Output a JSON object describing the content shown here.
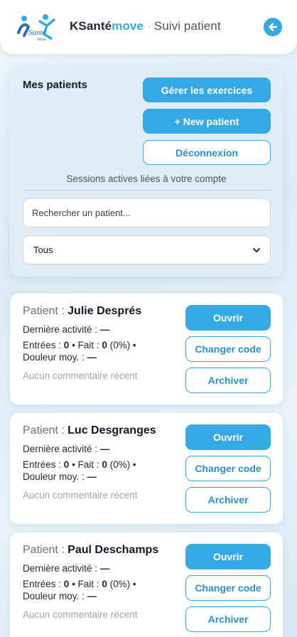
{
  "header": {
    "brand_main": "KSanté",
    "brand_accent": "move",
    "separator": "·",
    "subtitle": "Suivi patient",
    "logo_text": "Santé Move",
    "accent_color": "#35a8e6"
  },
  "panel": {
    "title": "Mes patients",
    "buttons": {
      "manage": "Gérer les exercices",
      "new_patient": "+ New patient",
      "logout": "Déconnexion"
    },
    "note": "Sessions actives liées à votre compte",
    "search_placeholder": "Rechercher un patient...",
    "filter_value": "Tous"
  },
  "patients": [
    {
      "label": "Patient :",
      "name": "Julie Després",
      "last_activity_label": "Dernière activité :",
      "last_activity_value": "—",
      "entries_label": "Entrées :",
      "entries_value": "0",
      "done_label": "Fait :",
      "done_value": "0",
      "done_pct": "(0%)",
      "pain_label": "Douleur moy. :",
      "pain_value": "—",
      "comment": "Aucun commentaire récent",
      "btn_open": "Ouvrir",
      "btn_code": "Changer code",
      "btn_archive": "Archiver"
    },
    {
      "label": "Patient :",
      "name": "Luc Desgranges",
      "last_activity_label": "Dernière activité :",
      "last_activity_value": "—",
      "entries_label": "Entrées :",
      "entries_value": "0",
      "done_label": "Fait :",
      "done_value": "0",
      "done_pct": "(0%)",
      "pain_label": "Douleur moy. :",
      "pain_value": "—",
      "comment": "Aucun commentaire récent",
      "btn_open": "Ouvrir",
      "btn_code": "Changer code",
      "btn_archive": "Archiver"
    },
    {
      "label": "Patient :",
      "name": "Paul Deschamps",
      "last_activity_label": "Dernière activité :",
      "last_activity_value": "—",
      "entries_label": "Entrées :",
      "entries_value": "0",
      "done_label": "Fait :",
      "done_value": "0",
      "done_pct": "(0%)",
      "pain_label": "Douleur moy. :",
      "pain_value": "—",
      "comment": "Aucun commentaire récent",
      "btn_open": "Ouvrir",
      "btn_code": "Changer code",
      "btn_archive": "Archiver"
    }
  ]
}
